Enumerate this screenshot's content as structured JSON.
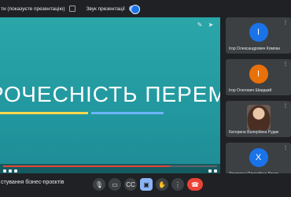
{
  "topbar": {
    "present_note": "ти (показуєте презентацію)",
    "sound_label": "Звук презентації"
  },
  "slide": {
    "title": "РОЧЕСНІСТЬ ПЕРЕМАГАЄ!",
    "accent_colors": {
      "underline_left": "#ffd84d",
      "underline_right": "#6db5ff",
      "background": "#2aa6a9"
    },
    "icons": [
      "pin-icon",
      "arrow-icon"
    ]
  },
  "video": {
    "progress": 0.78
  },
  "participants": [
    {
      "initial": "І",
      "name": "Ігор Олександрович Компан",
      "avatar_color": "#1a73e8",
      "type": "initial"
    },
    {
      "initial": "І",
      "name": "Ігор Олегович Швидкий",
      "avatar_color": "#e8710a",
      "type": "initial"
    },
    {
      "initial": "",
      "name": "Катерина Валеріївна Рудик",
      "avatar_color": "",
      "type": "photo"
    },
    {
      "initial": "Х",
      "name": "Христина Олексіївна Кошм…",
      "avatar_color": "#1a73e8",
      "type": "initial"
    }
  ],
  "meeting": {
    "title": "стування бізнес-проєктів"
  },
  "controls": [
    "mic-icon",
    "camera-icon",
    "captions-icon",
    "present-icon",
    "raise-hand-icon",
    "more-icon",
    "end-call-icon"
  ]
}
